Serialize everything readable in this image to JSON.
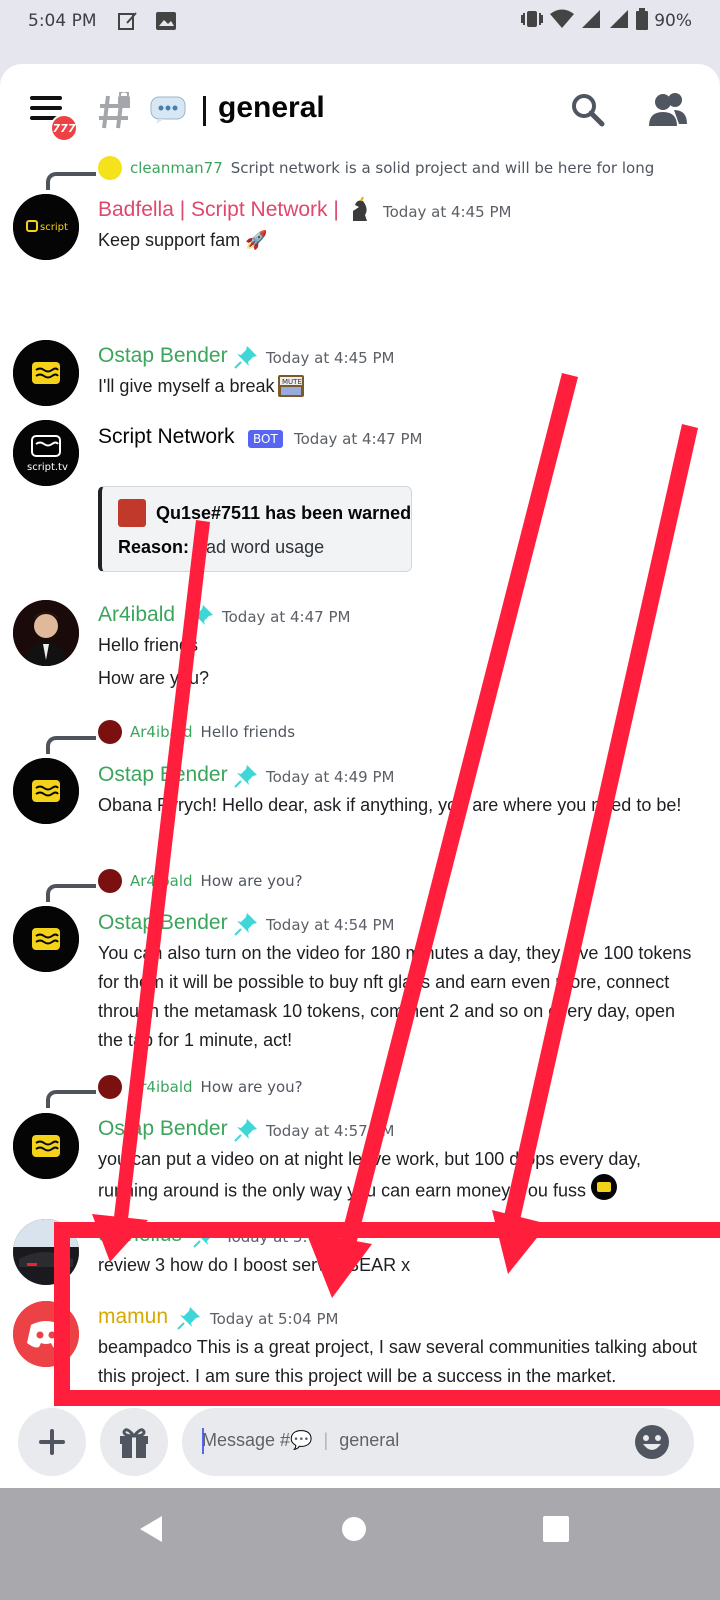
{
  "status_bar": {
    "time": "5:04 PM",
    "battery": "90%"
  },
  "header": {
    "badge": "777",
    "channel_name": "general"
  },
  "messages": [
    {
      "reply_to": {
        "name": "cleanman77",
        "text": "Script network is a solid project and will be here for long"
      },
      "author": "Badfella | Script Network |",
      "author_color": "#e0476e",
      "time": "Today at 4:45 PM",
      "text": "Keep support fam 🚀"
    },
    {
      "author": "Ostap Bender",
      "author_color": "#3ba55c",
      "time": "Today at 4:45 PM",
      "text": "I'll give myself a break"
    },
    {
      "author": "Script Network",
      "author_color": "#060607",
      "bot_tag": "BOT",
      "time": "Today at 4:47 PM",
      "embed": {
        "title": "Qu1se#7511 has been warned",
        "reason_label": "Reason:",
        "reason": "Bad word usage"
      }
    },
    {
      "author": "Ar4ibald",
      "author_color": "#3ba55c",
      "time": "Today at 4:47 PM",
      "lines": [
        "Hello friends",
        "How are you?"
      ]
    },
    {
      "reply_to": {
        "name": "Ar4ibald",
        "text": "Hello friends"
      },
      "author": "Ostap Bender",
      "author_color": "#3ba55c",
      "time": "Today at 4:49 PM",
      "text": "Obana Pyrych! Hello dear, ask if anything, you are where you need to be!"
    },
    {
      "reply_to": {
        "name": "Ar4ibald",
        "text": "How are you?"
      },
      "author": "Ostap Bender",
      "author_color": "#3ba55c",
      "time": "Today at 4:54 PM",
      "text": "You can also turn on the video for 180 minutes a day, they give 100 tokens for them it will be possible to buy nft glass and earn even more, connect through the metamask 10 tokens, comment 2 and so on every day, open the tab for 1 minute, act!"
    },
    {
      "reply_to": {
        "name": "Ar4ibald",
        "text": "How are you?"
      },
      "author": "Ostap Bender",
      "author_color": "#3ba55c",
      "time": "Today at 4:57 PM",
      "text": "you can put a video on at night leave work, but 100 drops every day, running around is the only way you can earn money, you fuss"
    },
    {
      "author": "cornelius",
      "author_color": "#3ba55c",
      "time": "Today at 5:04 PM",
      "text": "review 3 how do I boost server BEAR x"
    },
    {
      "author": "mamun",
      "author_color": "#d6a800",
      "time": "Today at 5:04 PM",
      "text": "beampadco This is a great project, I saw several communities talking about this project. I am sure this project will be a success in the market. Beampad realestate REAT blockchain crypto BEAM"
    }
  ],
  "composer": {
    "placeholder_prefix": "Message #💬",
    "placeholder_channel": "general"
  },
  "colors": {
    "highlight_red": "#ff1f3d",
    "discord_blurple": "#5865f2"
  }
}
